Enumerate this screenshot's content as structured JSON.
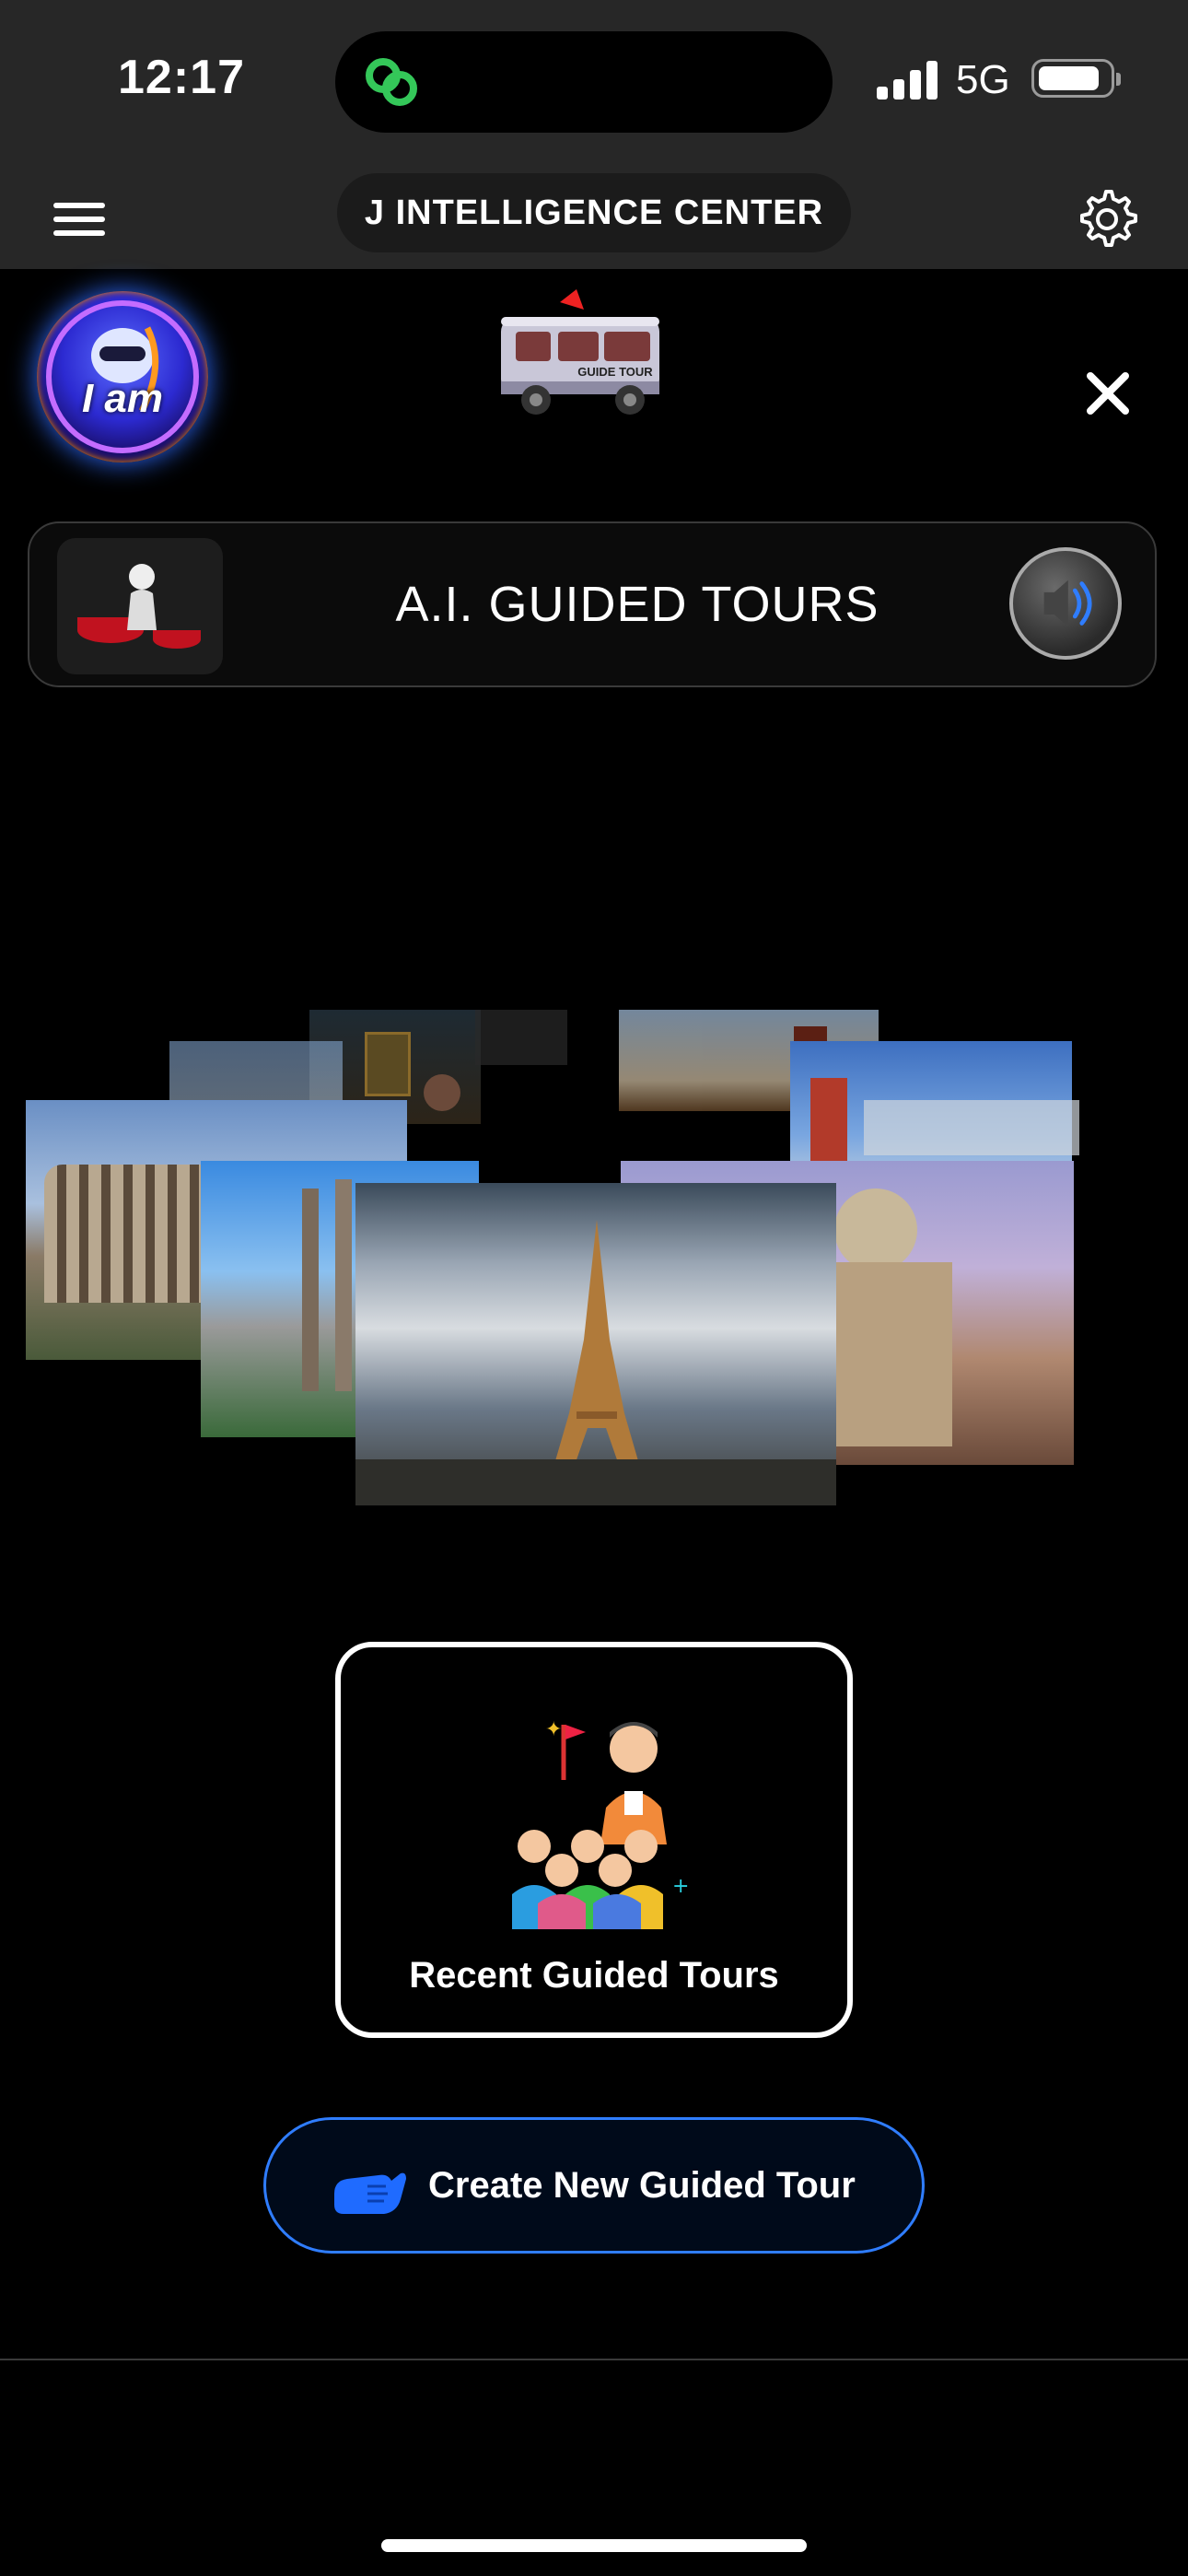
{
  "status_bar": {
    "time": "12:17",
    "network": "5G"
  },
  "top_bar": {
    "title": "J INTELLIGENCE CENTER"
  },
  "avatar": {
    "text": "I am"
  },
  "van": {
    "sign": "GUIDE TOUR"
  },
  "banner": {
    "title": "A.I. GUIDED TOURS"
  },
  "collage": {
    "photos": [
      "mona-lisa",
      "beijing-temple",
      "notre-dame",
      "japanese-pagoda",
      "colosseum",
      "sagrada-familia",
      "stadium",
      "st-peters-basilica",
      "eiffel-tower"
    ]
  },
  "recent": {
    "label": "Recent Guided Tours"
  },
  "create": {
    "label": "Create New Guided Tour"
  },
  "colors": {
    "accent": "#2f7dff",
    "island_icon": "#34c759"
  }
}
